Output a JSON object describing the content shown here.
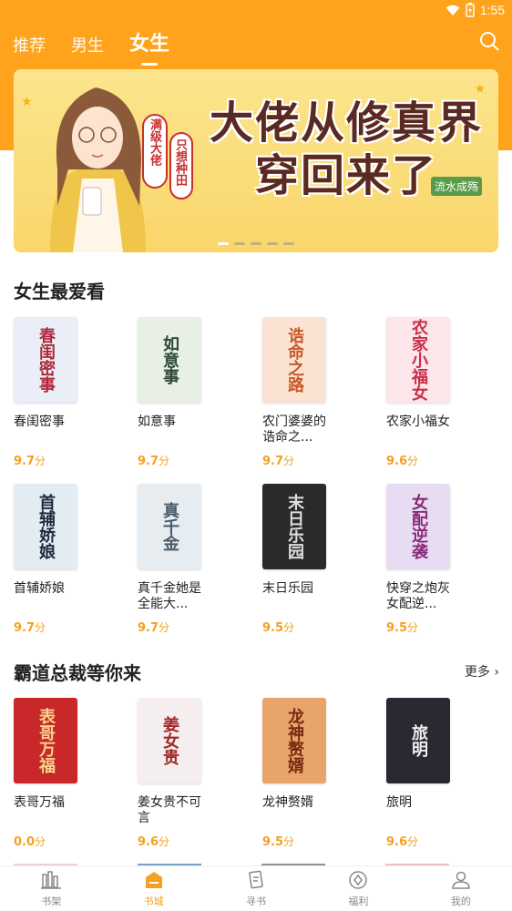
{
  "status": {
    "time": "1:55"
  },
  "tabs": [
    {
      "label": "推荐"
    },
    {
      "label": "男生"
    },
    {
      "label": "女生",
      "active": true
    }
  ],
  "banner": {
    "title_line1": "大佬从修真界",
    "title_line2": "穿回来了",
    "side_text_1": "满级大佬",
    "side_text_2": "只想种田",
    "author": "流水成殇",
    "dots": 5,
    "active_dot": 0
  },
  "section1": {
    "title": "女生最爱看",
    "books": [
      {
        "title": "春闺密事",
        "score": "9.7",
        "unit": "分",
        "cover_text": "春闺密事",
        "cover_bg": "#e9eef8",
        "cover_fg": "#b02a3a"
      },
      {
        "title": "如意事",
        "score": "9.7",
        "unit": "分",
        "cover_text": "如意事",
        "cover_bg": "#e8efe4",
        "cover_fg": "#2f4a3a"
      },
      {
        "title": "农门婆婆的诰命之...",
        "score": "9.7",
        "unit": "分",
        "cover_text": "诰命之路",
        "cover_bg": "#fbe3d3",
        "cover_fg": "#c85a2a"
      },
      {
        "title": "农家小福女",
        "score": "9.6",
        "unit": "分",
        "cover_text": "农家小福女",
        "cover_bg": "#fde6ea",
        "cover_fg": "#c8304a"
      },
      {
        "title": "首辅娇娘",
        "score": "9.7",
        "unit": "分",
        "cover_text": "首辅娇娘",
        "cover_bg": "#e3ecf3",
        "cover_fg": "#1e2a3a"
      },
      {
        "title": "真千金她是全能大...",
        "score": "9.7",
        "unit": "分",
        "cover_text": "真千金",
        "cover_bg": "#e6ecf0",
        "cover_fg": "#4a5a6a"
      },
      {
        "title": "末日乐园",
        "score": "9.5",
        "unit": "分",
        "cover_text": "末日乐园",
        "cover_bg": "#2a2a2a",
        "cover_fg": "#dddddd"
      },
      {
        "title": "快穿之炮灰女配逆...",
        "score": "9.5",
        "unit": "分",
        "cover_text": "女配逆袭",
        "cover_bg": "#e7dcf2",
        "cover_fg": "#8a2a7a"
      }
    ]
  },
  "section2": {
    "title": "霸道总裁等你来",
    "more": "更多",
    "books": [
      {
        "title": "表哥万福",
        "score": "0.0",
        "unit": "分",
        "cover_text": "表哥万福",
        "cover_bg": "#c8282a",
        "cover_fg": "#f5d38a"
      },
      {
        "title": "姜女贵不可言",
        "score": "9.6",
        "unit": "分",
        "cover_text": "姜女贵",
        "cover_bg": "#f5eeee",
        "cover_fg": "#a02a2a"
      },
      {
        "title": "龙神赘婿",
        "score": "9.5",
        "unit": "分",
        "cover_text": "龙神赘婿",
        "cover_bg": "#e8a46a",
        "cover_fg": "#7a2a10"
      },
      {
        "title": "旅明",
        "score": "9.6",
        "unit": "分",
        "cover_text": "旅明",
        "cover_bg": "#2a2830",
        "cover_fg": "#eeeeee"
      }
    ]
  },
  "nav": [
    {
      "label": "书架",
      "icon": "bookshelf-icon"
    },
    {
      "label": "书城",
      "icon": "bookstore-icon",
      "active": true
    },
    {
      "label": "寻书",
      "icon": "find-book-icon"
    },
    {
      "label": "福利",
      "icon": "welfare-icon"
    },
    {
      "label": "我的",
      "icon": "profile-icon"
    }
  ],
  "colors": {
    "accent": "#fea31b",
    "score": "#f4a020"
  }
}
